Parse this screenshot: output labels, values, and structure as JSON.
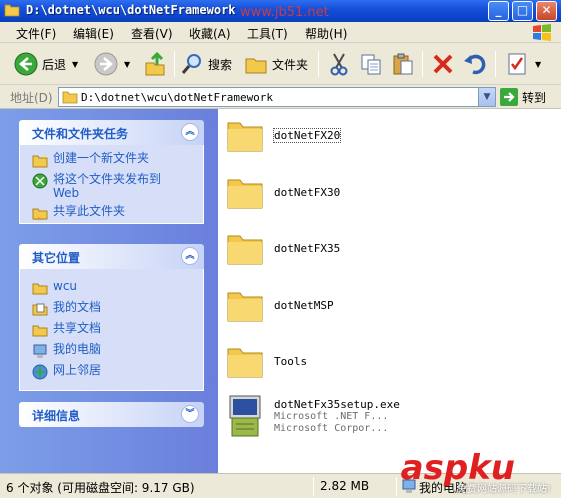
{
  "window": {
    "title": "D:\\dotnet\\wcu\\dotNetFramework",
    "watermark": "www.jb51.net",
    "minimize": "_",
    "maximize": "□",
    "close": "✕"
  },
  "menu": [
    "文件(F)",
    "编辑(E)",
    "查看(V)",
    "收藏(A)",
    "工具(T)",
    "帮助(H)"
  ],
  "toolbar": {
    "back_label": "后退",
    "search_label": "搜索",
    "folders_label": "文件夹"
  },
  "address": {
    "label": "地址(D)",
    "value": "D:\\dotnet\\wcu\\dotNetFramework",
    "go_label": "转到"
  },
  "panels": [
    {
      "title": "文件和文件夹任务",
      "items": [
        {
          "label": "创建一个新文件夹",
          "icon": "new-folder-icon"
        },
        {
          "label": "将这个文件夹发布到 Web",
          "icon": "publish-web-icon"
        },
        {
          "label": "共享此文件夹",
          "icon": "share-folder-icon"
        }
      ]
    },
    {
      "title": "其它位置",
      "items": [
        {
          "label": "wcu",
          "icon": "folder-icon"
        },
        {
          "label": "我的文档",
          "icon": "my-documents-icon"
        },
        {
          "label": "共享文档",
          "icon": "shared-documents-icon"
        },
        {
          "label": "我的电脑",
          "icon": "my-computer-icon"
        },
        {
          "label": "网上邻居",
          "icon": "network-icon"
        }
      ]
    },
    {
      "title": "详细信息",
      "items": []
    }
  ],
  "files": [
    {
      "name": "dotNetFX20",
      "type": "folder"
    },
    {
      "name": "dotNetFX30",
      "type": "folder"
    },
    {
      "name": "dotNetFX35",
      "type": "folder"
    },
    {
      "name": "dotNetMSP",
      "type": "folder"
    },
    {
      "name": "Tools",
      "type": "folder"
    },
    {
      "name": "dotNetFx35setup.exe",
      "type": "exe",
      "meta1": "Microsoft .NET F...",
      "meta2": "Microsoft Corpor..."
    }
  ],
  "status": {
    "objects": "6 个对象 (可用磁盘空间: 9.17 GB)",
    "size": "2.82 MB",
    "location": "我的电脑"
  },
  "logo": {
    "brand": "aspku",
    "tagline": "免费网站源码下载站!"
  },
  "colors": {
    "titlebar": "#0a43c8",
    "taskpane": "#7c9ee8",
    "link": "#215dc6",
    "folder": "#f4c84a"
  }
}
